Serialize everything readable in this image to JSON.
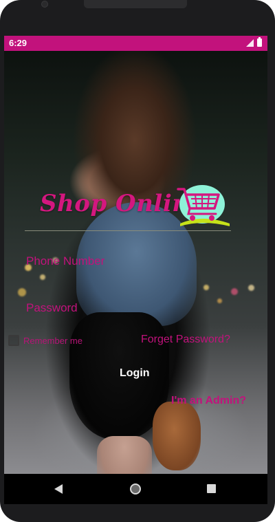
{
  "status_bar": {
    "time": "6:29",
    "icons": [
      "signal-icon",
      "battery-icon"
    ],
    "color": "#c2127c"
  },
  "header": {
    "title": "Shop Online",
    "logo_icon": "shopping-cart-icon"
  },
  "form": {
    "phone_placeholder": "Phone Number",
    "password_placeholder": "Password",
    "remember_label": "Remember me",
    "forgot_label": "Forget Password?",
    "login_label": "Login",
    "admin_label": "I'm an Admin?"
  },
  "nav_bar": {
    "icons": [
      "back-icon",
      "home-icon",
      "recents-icon"
    ]
  },
  "colors": {
    "accent": "#c2127c",
    "title": "#d4177f",
    "cart_bg": "#8ef2d8",
    "cart_base": "#c6e21a"
  }
}
